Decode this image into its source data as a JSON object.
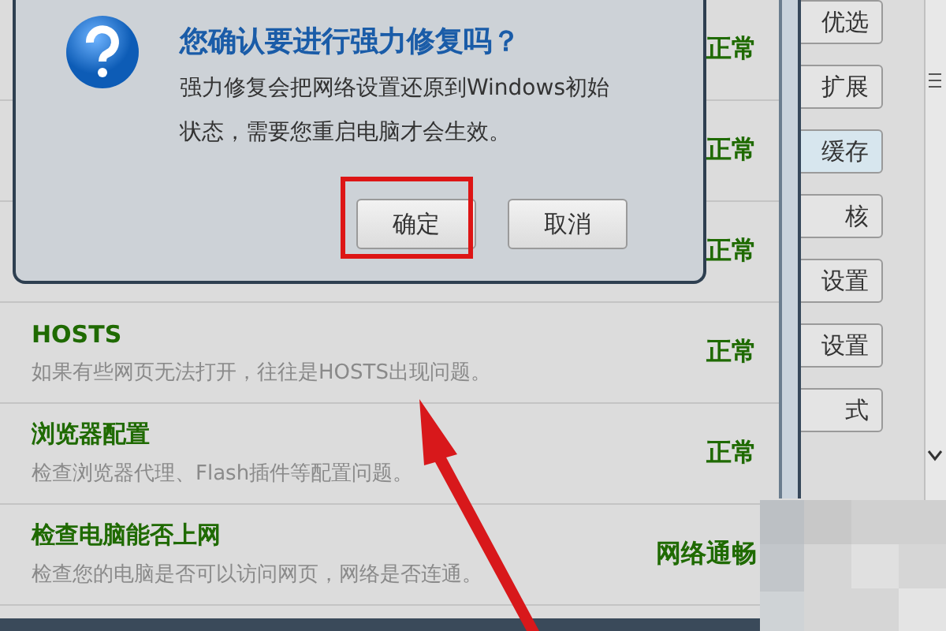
{
  "dialog": {
    "title": "您确认要进行强力修复吗？",
    "message": "强力修复会把网络设置还原到Windows初始状态，需要您重启电脑才会生效。",
    "buttons": [
      {
        "label": "确定",
        "highlighted": true
      },
      {
        "label": "取消",
        "highlighted": false
      }
    ]
  },
  "rows": [
    {
      "status": "正常"
    },
    {
      "status": "正常"
    },
    {
      "status": "正常"
    },
    {
      "title": "HOSTS",
      "description": "如果有些网页无法打开，往往是HOSTS出现问题。",
      "status": "正常"
    },
    {
      "title": "浏览器配置",
      "description": "检查浏览器代理、Flash插件等配置问题。",
      "status": "正常"
    },
    {
      "title": "检查电脑能否上网",
      "description": "检查您的电脑是否可以访问网页，网络是否连通。",
      "status": "网络通畅"
    }
  ],
  "side_buttons": [
    {
      "label": "优选",
      "selected": false
    },
    {
      "label": "扩展",
      "selected": false
    },
    {
      "label": "缓存",
      "selected": true
    },
    {
      "label": "核",
      "selected": false
    },
    {
      "label": "设置",
      "selected": false
    },
    {
      "label": "设置",
      "selected": false
    },
    {
      "label": "式",
      "selected": false
    }
  ]
}
